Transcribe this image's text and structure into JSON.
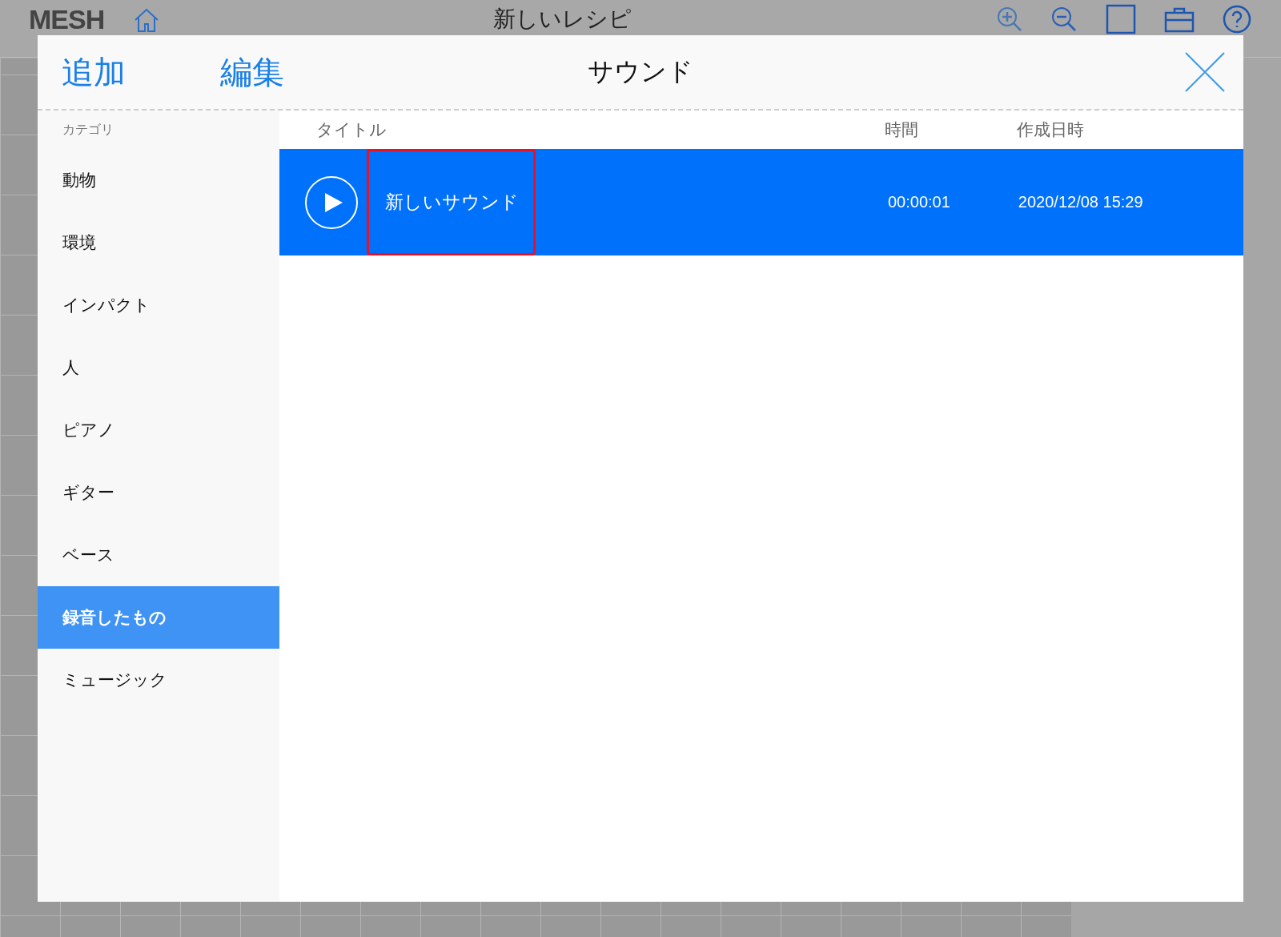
{
  "app_header": {
    "logo": "MESH",
    "title": "新しいレシピ"
  },
  "dialog": {
    "actions": [
      {
        "label": "追加"
      },
      {
        "label": "編集"
      }
    ],
    "title": "サウンド"
  },
  "sidebar": {
    "heading": "カテゴリ",
    "items": [
      {
        "label": "動物",
        "selected": false
      },
      {
        "label": "環境",
        "selected": false
      },
      {
        "label": "インパクト",
        "selected": false
      },
      {
        "label": "人",
        "selected": false
      },
      {
        "label": "ピアノ",
        "selected": false
      },
      {
        "label": "ギター",
        "selected": false
      },
      {
        "label": "ベース",
        "selected": false
      },
      {
        "label": "録音したもの",
        "selected": true
      },
      {
        "label": "ミュージック",
        "selected": false
      }
    ]
  },
  "table": {
    "columns": [
      "タイトル",
      "時間",
      "作成日時"
    ],
    "rows": [
      {
        "title": "新しいサウンド",
        "time": "00:00:01",
        "created": "2020/12/08 15:29",
        "selected": true,
        "highlighted": true
      }
    ]
  }
}
